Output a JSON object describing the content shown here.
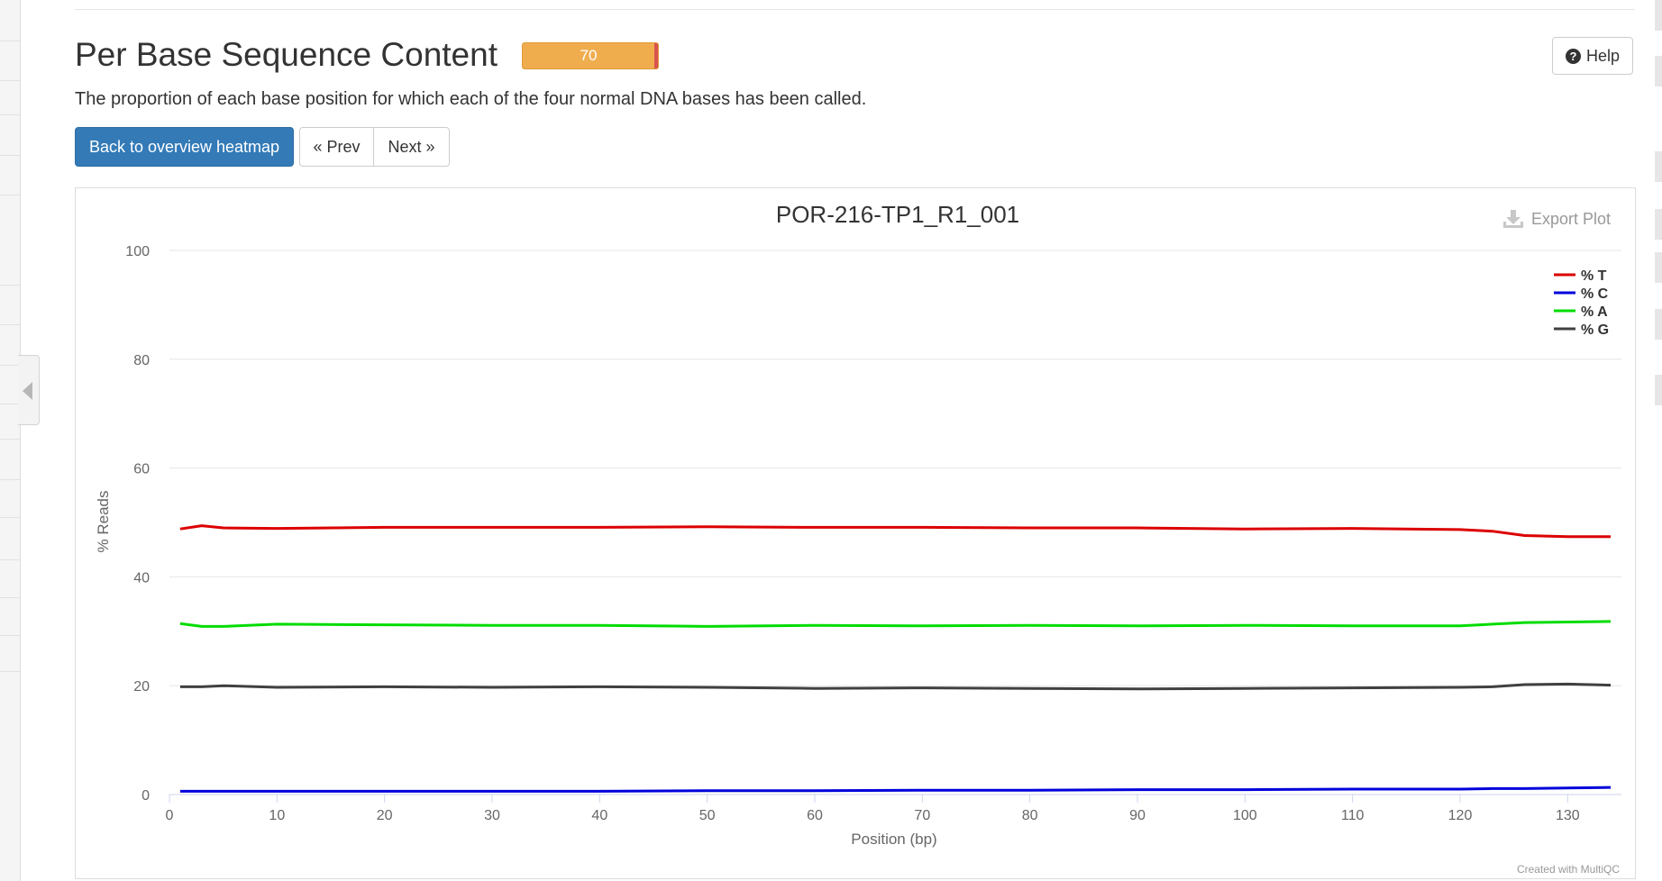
{
  "header": {
    "title": "Per Base Sequence Content",
    "status_value": "70",
    "help_label": "Help",
    "description": "The proportion of each base position for which each of the four normal DNA bases has been called."
  },
  "nav": {
    "overview_label": "Back to overview heatmap",
    "prev_label": "« Prev",
    "next_label": "Next »"
  },
  "plot": {
    "export_label": "Export Plot",
    "credit": "Created with MultiQC"
  },
  "colors": {
    "status_bar": "#f0ad4e",
    "primary_button": "#337ab7",
    "T": "#dc0000",
    "C": "#0000dc",
    "A": "#00dc00",
    "G": "#404040"
  },
  "icons": {
    "help": "question-circle-icon",
    "export": "download-icon",
    "sidebar_toggle": "caret-left-icon"
  },
  "chart_data": {
    "type": "line",
    "title": "POR-216-TP1_R1_001",
    "xlabel": "Position (bp)",
    "ylabel": "% Reads",
    "xlim": [
      0,
      135
    ],
    "ylim": [
      0,
      100
    ],
    "xticks": [
      0,
      10,
      20,
      30,
      40,
      50,
      60,
      70,
      80,
      90,
      100,
      110,
      120,
      130
    ],
    "yticks": [
      0,
      20,
      40,
      60,
      80,
      100
    ],
    "grid": true,
    "legend_position": "top-right",
    "x": [
      1,
      3,
      5,
      10,
      20,
      30,
      40,
      50,
      60,
      70,
      80,
      90,
      100,
      110,
      120,
      123,
      126,
      130,
      134
    ],
    "series": [
      {
        "name": "% T",
        "color": "#dc0000",
        "values": [
          48.8,
          49.4,
          49.0,
          48.9,
          49.1,
          49.1,
          49.1,
          49.2,
          49.1,
          49.1,
          49.0,
          49.0,
          48.8,
          48.9,
          48.7,
          48.4,
          47.6,
          47.4,
          47.4
        ]
      },
      {
        "name": "% C",
        "color": "#0000dc",
        "values": [
          0.6,
          0.6,
          0.6,
          0.6,
          0.6,
          0.6,
          0.6,
          0.7,
          0.7,
          0.8,
          0.8,
          0.9,
          0.9,
          1.0,
          1.0,
          1.1,
          1.1,
          1.2,
          1.3
        ]
      },
      {
        "name": "% A",
        "color": "#00dc00",
        "values": [
          31.4,
          30.9,
          30.9,
          31.3,
          31.2,
          31.1,
          31.1,
          30.9,
          31.1,
          31.0,
          31.1,
          31.0,
          31.1,
          31.0,
          31.0,
          31.3,
          31.6,
          31.7,
          31.8
        ]
      },
      {
        "name": "% G",
        "color": "#404040",
        "values": [
          19.8,
          19.8,
          20.0,
          19.7,
          19.8,
          19.7,
          19.8,
          19.7,
          19.5,
          19.6,
          19.5,
          19.4,
          19.5,
          19.6,
          19.7,
          19.8,
          20.2,
          20.3,
          20.1
        ]
      }
    ]
  }
}
